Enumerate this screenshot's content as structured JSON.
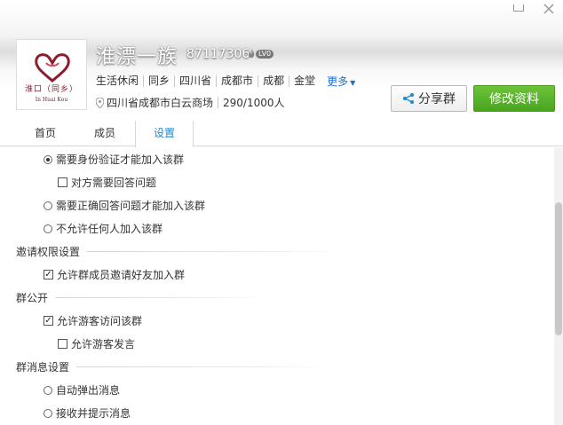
{
  "window": {
    "minimize_icon": "minimize-icon",
    "close_icon": "close-icon"
  },
  "group": {
    "name": "淮漂一族",
    "id": "87117306",
    "level": "LV0",
    "logo_text": "淮口（同乡）",
    "logo_sub": "In Huai Kou",
    "tags": [
      "生活休闲",
      "同乡",
      "四川省",
      "成都市",
      "成都",
      "金堂"
    ],
    "more_label": "更多",
    "location": "四川省成都市白云商场",
    "members": "290/1000人"
  },
  "buttons": {
    "share_label": "分享群",
    "edit_label": "修改资料"
  },
  "tabs": {
    "home": "首页",
    "members": "成员",
    "settings": "设置"
  },
  "settings": {
    "join": {
      "opt_verify": "需要身份验证才能加入该群",
      "opt_answer_required": "对方需要回答问题",
      "opt_correct_answer": "需要正确回答问题才能加入该群",
      "opt_disallow": "不允许任何人加入该群"
    },
    "invite": {
      "title": "邀请权限设置",
      "opt_member_invite": "允许群成员邀请好友加入群"
    },
    "public": {
      "title": "群公开",
      "opt_visitor_access": "允许游客访问该群",
      "opt_visitor_speak": "允许游客发言"
    },
    "message": {
      "title": "群消息设置",
      "opt_popup": "自动弹出消息",
      "opt_receive": "接收并提示消息"
    }
  },
  "colors": {
    "accent_blue": "#1e8ad6",
    "edit_green": "#52ad24",
    "logo_red": "#7a1f2b"
  }
}
